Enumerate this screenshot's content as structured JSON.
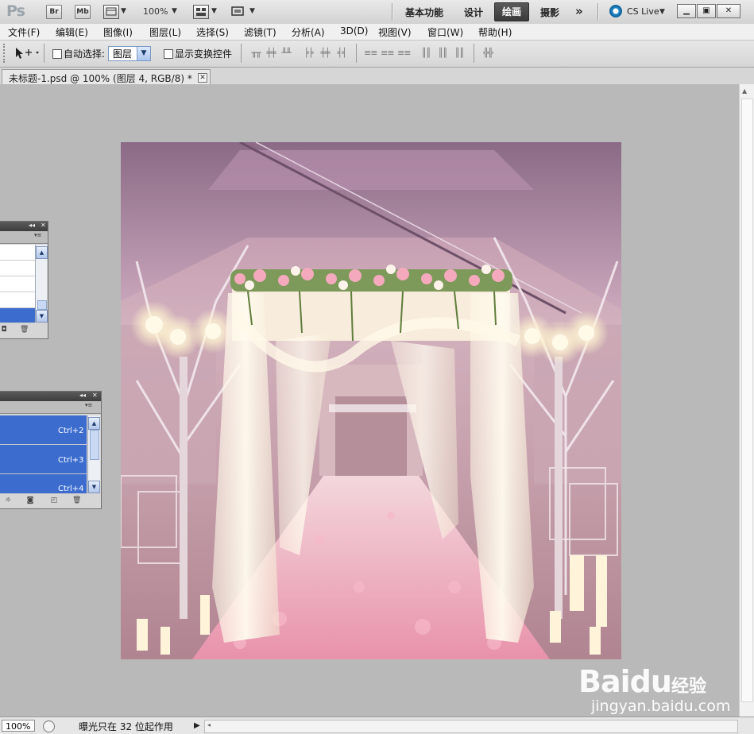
{
  "app": {
    "logo": "Ps",
    "bridge_label": "Br",
    "minibridge_label": "Mb",
    "zoom": "100%",
    "workspaces": [
      "基本功能",
      "设计",
      "绘画",
      "摄影"
    ],
    "active_workspace": "绘画",
    "more": "»",
    "cs_live": "CS Live"
  },
  "menu": [
    "文件(F)",
    "编辑(E)",
    "图像(I)",
    "图层(L)",
    "选择(S)",
    "滤镜(T)",
    "分析(A)",
    "3D(D)",
    "视图(V)",
    "窗口(W)",
    "帮助(H)"
  ],
  "options": {
    "auto_select_label": "自动选择:",
    "auto_select_value": "图层",
    "show_transform_label": "显示变换控件"
  },
  "document": {
    "tab_title": "未标题-1.psd @ 100% (图层 4, RGB/8) *"
  },
  "panel_actions": {
    "shortcuts": [
      "Ctrl+2",
      "Ctrl+3",
      "Ctrl+4"
    ]
  },
  "status": {
    "zoom": "100%",
    "info": "曝光只在 32 位起作用"
  },
  "watermark": {
    "logo": "Baidu",
    "cn": "经验",
    "url": "jingyan.baidu.com"
  },
  "colors": {
    "active_workspace_bg": "#3e3e3e",
    "selection_blue": "#3b6cce",
    "canvas_gray": "#b9b9b9"
  }
}
